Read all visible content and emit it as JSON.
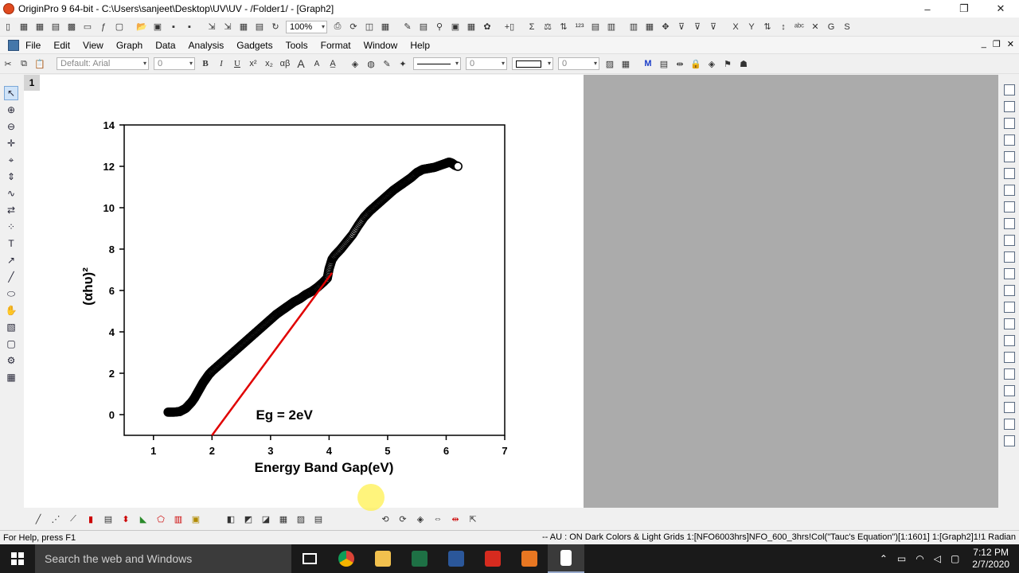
{
  "window": {
    "title": "OriginPro 9 64-bit - C:\\Users\\sanjeet\\Desktop\\UV\\UV - /Folder1/ - [Graph2]",
    "controls": [
      "–",
      "❐",
      "✕"
    ]
  },
  "toolbar1": {
    "zoom": "100%"
  },
  "menu": {
    "items": [
      "File",
      "Edit",
      "View",
      "Graph",
      "Data",
      "Analysis",
      "Gadgets",
      "Tools",
      "Format",
      "Window",
      "Help"
    ],
    "mdi_controls": [
      "_",
      "❐",
      "✕"
    ]
  },
  "format_toolbar": {
    "font": "Default: Arial",
    "font_size": "0",
    "line_width": "0",
    "border_width": "0",
    "bold": "B",
    "italic": "I",
    "underline": "U",
    "superscript": "x²",
    "subscript": "x₂",
    "greek": "αβ",
    "increase_font": "A",
    "decrease_font": "A"
  },
  "page": {
    "tab_label": "1"
  },
  "chart_data": {
    "type": "scatter",
    "xlabel": "Energy Band Gap(eV)",
    "ylabel": "(αhυ)²",
    "xlim": [
      0.5,
      7
    ],
    "ylim": [
      -1,
      14
    ],
    "x_ticks": [
      1,
      2,
      3,
      4,
      5,
      6,
      7
    ],
    "y_ticks": [
      0,
      2,
      4,
      6,
      8,
      10,
      12,
      14
    ],
    "annotation": "Eg = 2eV",
    "series": [
      {
        "style": "open-circle",
        "color": "#000000",
        "x": [
          1.25,
          1.35,
          1.45,
          1.55,
          1.6,
          1.65,
          1.7,
          1.75,
          1.8,
          1.85,
          1.9,
          1.95,
          2.0,
          2.1,
          2.2,
          2.3,
          2.4,
          2.5,
          2.6,
          2.7,
          2.8,
          2.9,
          3.0,
          3.1,
          3.2,
          3.3,
          3.4,
          3.5,
          3.6,
          3.7,
          3.8,
          3.9,
          3.97,
          4.0,
          4.05,
          4.1,
          4.2,
          4.3,
          4.4,
          4.5,
          4.6,
          4.7,
          4.8,
          4.9,
          5.0,
          5.1,
          5.2,
          5.3,
          5.4,
          5.5,
          5.6,
          5.7,
          5.8,
          5.9,
          6.0,
          6.05,
          6.1,
          6.15,
          6.2
        ],
        "y": [
          0.12,
          0.12,
          0.15,
          0.3,
          0.45,
          0.6,
          0.8,
          1.05,
          1.3,
          1.55,
          1.75,
          1.95,
          2.1,
          2.35,
          2.6,
          2.85,
          3.1,
          3.35,
          3.6,
          3.85,
          4.1,
          4.35,
          4.6,
          4.85,
          5.05,
          5.25,
          5.45,
          5.6,
          5.8,
          5.95,
          6.15,
          6.4,
          6.6,
          7.05,
          7.5,
          7.7,
          8.0,
          8.35,
          8.7,
          9.15,
          9.55,
          9.85,
          10.1,
          10.35,
          10.6,
          10.85,
          11.05,
          11.25,
          11.45,
          11.7,
          11.85,
          11.9,
          11.95,
          12.05,
          12.15,
          12.2,
          12.15,
          12.05,
          12.0
        ]
      },
      {
        "style": "line",
        "color": "#e00000",
        "x": [
          2.0,
          4.05
        ],
        "y": [
          -1.0,
          6.85
        ]
      }
    ]
  },
  "status": {
    "help": "For Help, press F1",
    "info": "-- AU : ON  Dark Colors & Light Grids  1:[NFO6003hrs]NFO_600_3hrs!Col(\"Tauc's Equation\")[1:1601]  1:[Graph2]1!1  Radian"
  },
  "taskbar": {
    "search_placeholder": "Search the web and Windows",
    "time": "7:12 PM",
    "date": "2/7/2020",
    "apps": [
      {
        "name": "task-view",
        "color": "#1a1a1a"
      },
      {
        "name": "chrome",
        "color": "#dd4b39"
      },
      {
        "name": "file-explorer",
        "color": "#f2c14e"
      },
      {
        "name": "excel",
        "color": "#1e7145"
      },
      {
        "name": "word",
        "color": "#2b579a"
      },
      {
        "name": "acrobat",
        "color": "#d62b1f"
      },
      {
        "name": "origin",
        "color": "#e87722"
      },
      {
        "name": "notepad",
        "color": "#ffffff"
      }
    ]
  }
}
